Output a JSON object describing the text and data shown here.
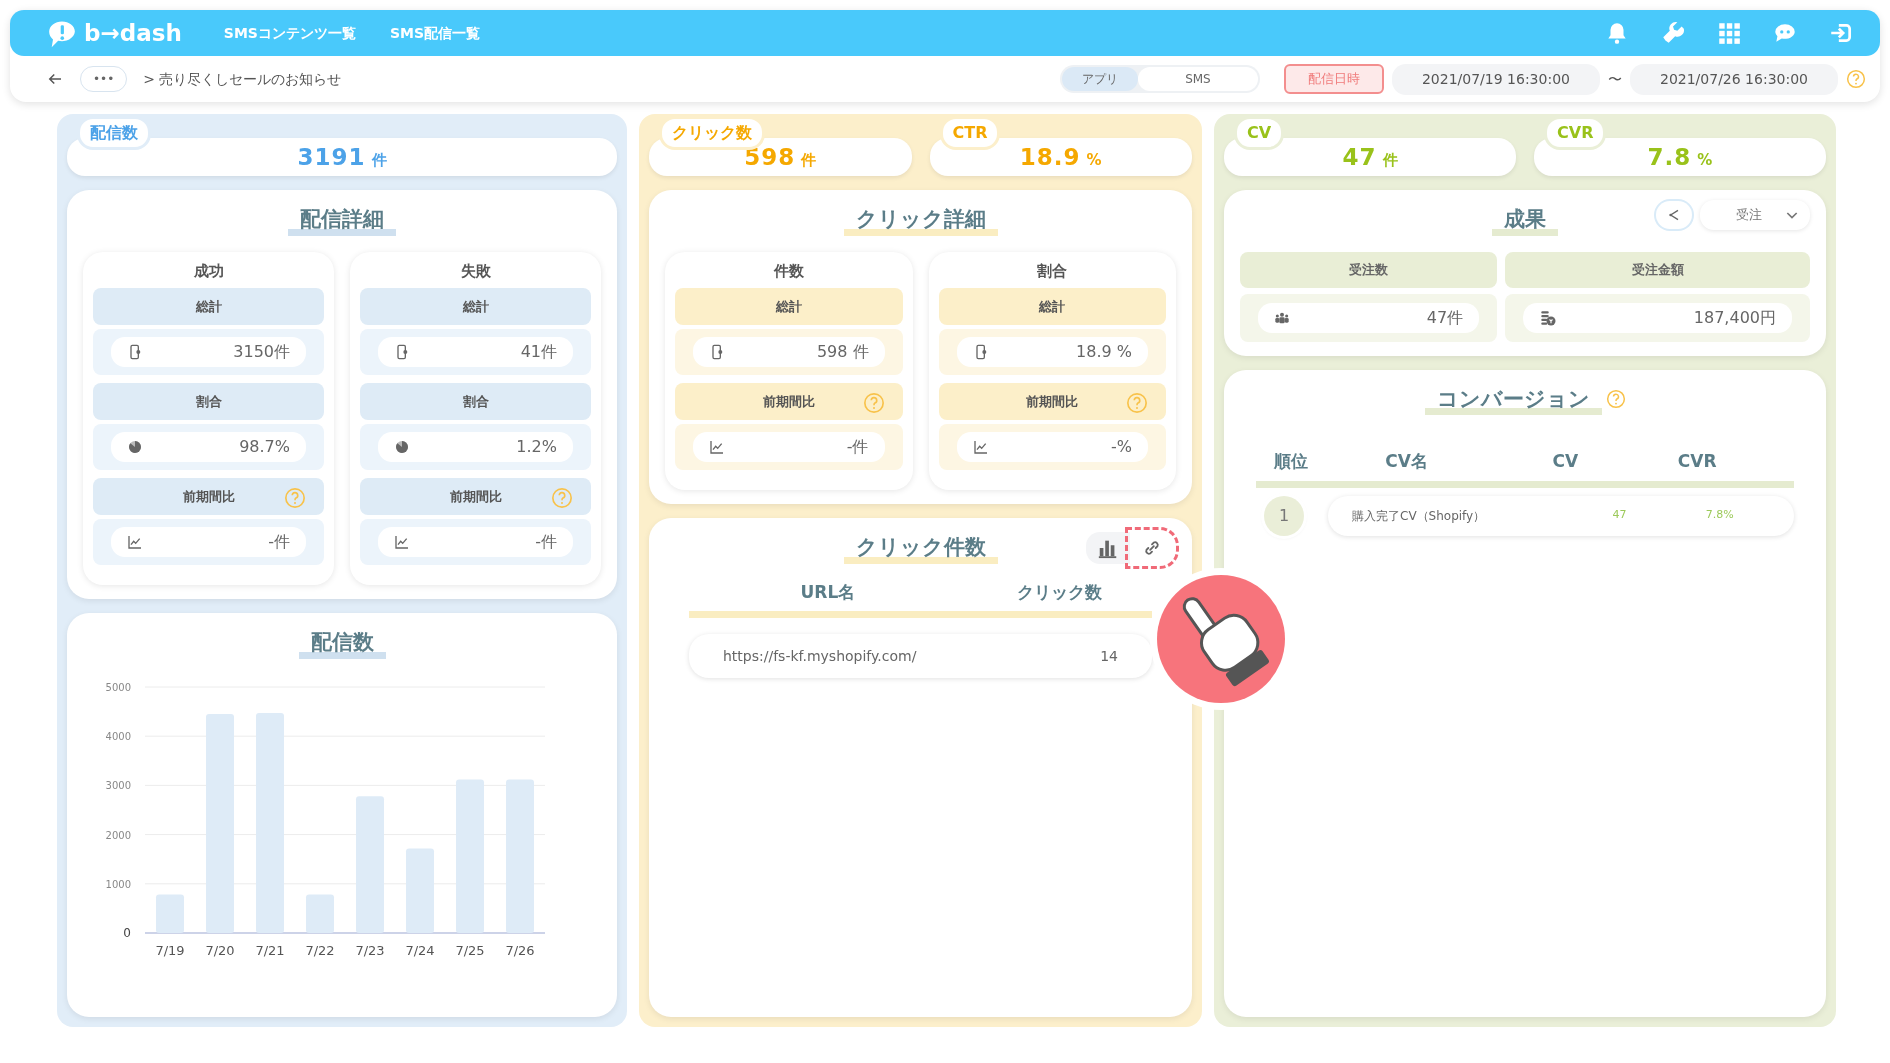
{
  "header": {
    "logo": "b→dash",
    "nav": [
      "SMSコンテンツ一覧",
      "SMS配信一覧"
    ]
  },
  "breadcrumb": {
    "more": "•••",
    "path": "> 売り尽くしセールのお知らせ"
  },
  "channel_toggle": [
    {
      "label": "アプリ",
      "selected": true
    },
    {
      "label": "SMS",
      "selected": false
    }
  ],
  "date_filter": {
    "label": "配信日時",
    "from": "2021/07/19 16:30:00",
    "separator": "〜",
    "to": "2021/07/26 16:30:00"
  },
  "delivery": {
    "kpis": [
      {
        "label": "配信数",
        "value": "3191",
        "unit": "件"
      }
    ],
    "detail": {
      "title": "配信詳細",
      "groups": [
        {
          "title": "成功",
          "sections": [
            {
              "label": "総計",
              "value": "3150件"
            },
            {
              "label": "割合",
              "value": "98.7%"
            },
            {
              "label": "前期間比",
              "value": "-件",
              "help": true
            }
          ]
        },
        {
          "title": "失敗",
          "sections": [
            {
              "label": "総計",
              "value": "41件"
            },
            {
              "label": "割合",
              "value": "1.2%"
            },
            {
              "label": "前期間比",
              "value": "-件",
              "help": true
            }
          ]
        }
      ]
    },
    "chart": {
      "title": "配信数",
      "chart_data": {
        "type": "bar",
        "categories": [
          "7/19",
          "7/20",
          "7/21",
          "7/22",
          "7/23",
          "7/24",
          "7/25",
          "7/26"
        ],
        "values": [
          780,
          4450,
          4470,
          780,
          2780,
          1720,
          3120,
          3120
        ],
        "grid": true,
        "ylim": [
          0,
          5000
        ],
        "yticks": [
          0,
          1000,
          2000,
          3000,
          4000,
          5000
        ]
      }
    }
  },
  "click": {
    "kpis": [
      {
        "label": "クリック数",
        "value": "598",
        "unit": "件"
      },
      {
        "label": "CTR",
        "value": "18.9",
        "unit": "%"
      }
    ],
    "detail": {
      "title": "クリック詳細",
      "groups": [
        {
          "title": "件数",
          "sections": [
            {
              "label": "総計",
              "value": "598 件"
            },
            {
              "label": "前期間比",
              "value": "-件",
              "help": true
            }
          ]
        },
        {
          "title": "割合",
          "sections": [
            {
              "label": "総計",
              "value": "18.9 %"
            },
            {
              "label": "前期間比",
              "value": "-%",
              "help": true
            }
          ]
        }
      ]
    },
    "table": {
      "title": "クリック件数",
      "columns": [
        "URL名",
        "クリック数"
      ],
      "rows": [
        [
          "https://fs-kf.myshopify.com/",
          "14"
        ]
      ]
    }
  },
  "conversion": {
    "kpis": [
      {
        "label": "CV",
        "value": "47",
        "unit": "件"
      },
      {
        "label": "CVR",
        "value": "7.8",
        "unit": "%"
      }
    ],
    "results": {
      "title": "成果",
      "dropdown": "受注",
      "metrics": [
        {
          "label": "受注数",
          "value": "47件"
        },
        {
          "label": "受注金額",
          "value": "187,400円"
        }
      ]
    },
    "table": {
      "title": "コンバージョン",
      "help": true,
      "columns": [
        "順位",
        "CV名",
        "CV",
        "CVR"
      ],
      "rows": [
        {
          "rank": "1",
          "name": "購入完了CV（Shopify）",
          "cv": "47",
          "cvr": "7.8%"
        }
      ]
    }
  }
}
